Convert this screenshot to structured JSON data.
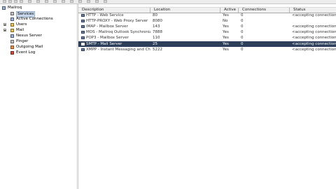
{
  "tree": {
    "root": "Mailroq",
    "items": [
      {
        "label": "Services",
        "icon": "services-icon",
        "selected": true
      },
      {
        "label": "Active Connections",
        "icon": "connections-icon"
      },
      {
        "label": "Users",
        "icon": "users-icon"
      },
      {
        "label": "Mail",
        "icon": "mail-icon"
      },
      {
        "label": "Nexus Server",
        "icon": "server-icon"
      },
      {
        "label": "Pinger",
        "icon": "pinger-icon"
      },
      {
        "label": "Outgoing Mail",
        "icon": "outgoing-mail-icon"
      },
      {
        "label": "Event Log",
        "icon": "event-log-icon"
      }
    ]
  },
  "list": {
    "columns": [
      "Description",
      "Location",
      "Active",
      "Connections",
      "Status"
    ],
    "rows": [
      {
        "description": "HTTP - Web Service",
        "location": "80",
        "active": "Yes",
        "connections": "0",
        "status": "<accepting connections on"
      },
      {
        "description": "HTTP-PROXY - Web Proxy Server",
        "location": "8080",
        "active": "No",
        "connections": "0",
        "status": ""
      },
      {
        "description": "IMAP - Mailbox Server",
        "location": "143",
        "active": "Yes",
        "connections": "0",
        "status": "<accepting connections on"
      },
      {
        "description": "MOS - Mailroq Outlook Synchroniz...",
        "location": "7888",
        "active": "Yes",
        "connections": "0",
        "status": "<accepting connections on"
      },
      {
        "description": "POP3 - Mailbox Server",
        "location": "110",
        "active": "Yes",
        "connections": "0",
        "status": "<accepting connections on"
      },
      {
        "description": "SMTP - Mail Server",
        "location": "25",
        "active": "Yes",
        "connections": "0",
        "status": "<accepting connections on",
        "selected": true
      },
      {
        "description": "XMPP - Instant Messaging and Ch...",
        "location": "5222",
        "active": "Yes",
        "connections": "0",
        "status": "<accepting connections on"
      }
    ]
  },
  "colors": {
    "selection": "#2c3e5a",
    "tree_selection": "#c8d8ec",
    "header_bg": "#f0f0f0"
  }
}
